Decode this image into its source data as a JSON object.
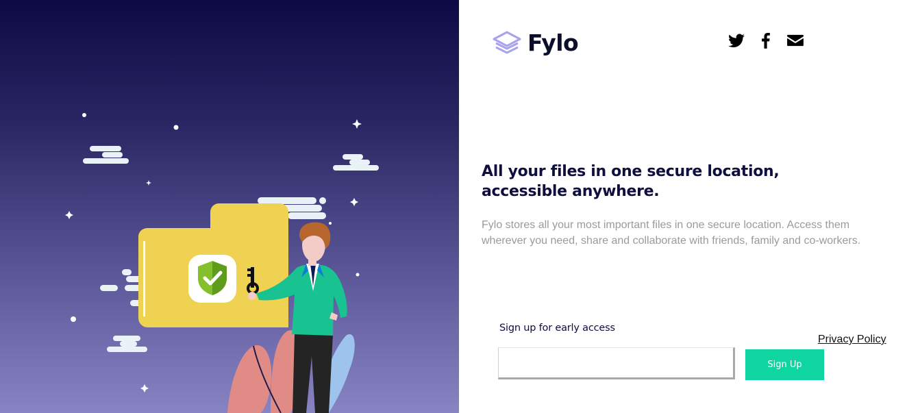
{
  "brand": {
    "name": "Fylo",
    "logo_icon": "stacked-layers-icon",
    "logo_color": "#a6a2ef"
  },
  "social_links": [
    {
      "name": "twitter",
      "icon": "twitter-icon"
    },
    {
      "name": "facebook",
      "icon": "facebook-icon"
    },
    {
      "name": "email",
      "icon": "envelope-icon"
    }
  ],
  "hero": {
    "headline": "All your files in one secure location, accessible anywhere.",
    "description": "Fylo stores all your most important files in one secure location. Access them wherever you need, share and collaborate with friends, family and co-workers."
  },
  "signup": {
    "label": "Sign up for early access",
    "input_value": "",
    "button_label": "Sign Up",
    "privacy_link": "Privacy Policy"
  },
  "colors": {
    "accent": "#0fd6a0",
    "heading": "#0e0e3f",
    "body_text": "#9a9a9a",
    "gradient_top": "#0d0a45",
    "gradient_bottom": "#8884c4"
  }
}
